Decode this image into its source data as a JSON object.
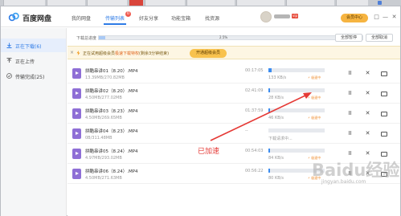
{
  "app": {
    "name": "百度网盘",
    "brand_color": "#2e7be6"
  },
  "nav": {
    "items": [
      {
        "label": "我的网盘",
        "active": false
      },
      {
        "label": "传输列表",
        "active": true
      },
      {
        "label": "好友分享",
        "active": false
      },
      {
        "label": "功能宝箱",
        "active": false
      },
      {
        "label": "找资源",
        "active": false
      }
    ],
    "badge": "0"
  },
  "user": {
    "vip_tag": "vip",
    "member_button": "会员中心"
  },
  "window_controls": {
    "restore": "□",
    "minimize": "—",
    "close": "✕"
  },
  "sidebar": {
    "items": [
      {
        "label": "正在下载(6)",
        "icon": "download-icon",
        "active": true
      },
      {
        "label": "正在上传",
        "icon": "upload-icon",
        "active": false
      },
      {
        "label": "传输完成(25)",
        "icon": "check-circle-icon",
        "active": false
      }
    ]
  },
  "speed": {
    "label": "下载总进度",
    "percent_text": "2.5%",
    "percent": 0.025,
    "rate": "287 KB/s",
    "pause_all": "全部暂停",
    "cancel_all": "全部取消"
  },
  "notice": {
    "text_prefix": "正在试用超级会员",
    "text_highlight": "极速下载特权",
    "text_suffix": "(剩余3分钟结束)",
    "button": "开通超级会员",
    "close": "×"
  },
  "tasks": [
    {
      "name": "拼酷串讲01（8.20）.MP4",
      "size": "13.39MB/270.82MB",
      "time": "00:17:05",
      "progress": 0.05,
      "speed": "133 KB/s",
      "accel": "⚡ 极速中",
      "status": ""
    },
    {
      "name": "拼酷串讲02（8.20）.MP4",
      "size": "4.50MB/277.02MB",
      "time": "02:41:09",
      "progress": 0.02,
      "speed": "28 KB/s",
      "accel": "⚡ 极速中",
      "status": ""
    },
    {
      "name": "拼酷串讲03（8.23）.MP4",
      "size": "4.50MB/269.65MB",
      "time": "01:37:59",
      "progress": 0.02,
      "speed": "46 KB/s",
      "accel": "⚡ 极速中",
      "status": ""
    },
    {
      "name": "拼酷串讲04（8.23）.MP4",
      "size": "0B/311.48MB",
      "time": "--",
      "progress": 0.0,
      "speed": "",
      "accel": "",
      "status": "下载请求中..."
    },
    {
      "name": "拼酷串讲05（8.24）.MP4",
      "size": "4.97MB/293.02MB",
      "time": "00:54:03",
      "progress": 0.02,
      "speed": "84 KB/s",
      "accel": "⚡ 极速中",
      "status": ""
    },
    {
      "name": "拼酷串讲06（8.24）.MP4",
      "size": "4.50MB/271.63MB",
      "time": "00:56:22",
      "progress": 0.02,
      "speed": "80 KB/s",
      "accel": "⚡ 极速中",
      "status": ""
    }
  ],
  "task_actions": {
    "pause": "II",
    "cancel": "✕"
  },
  "annotation": {
    "label": "已加速",
    "color": "#e53935"
  },
  "watermark": {
    "text": "Baidu经验",
    "sub": "jingyan.baidu.com"
  }
}
